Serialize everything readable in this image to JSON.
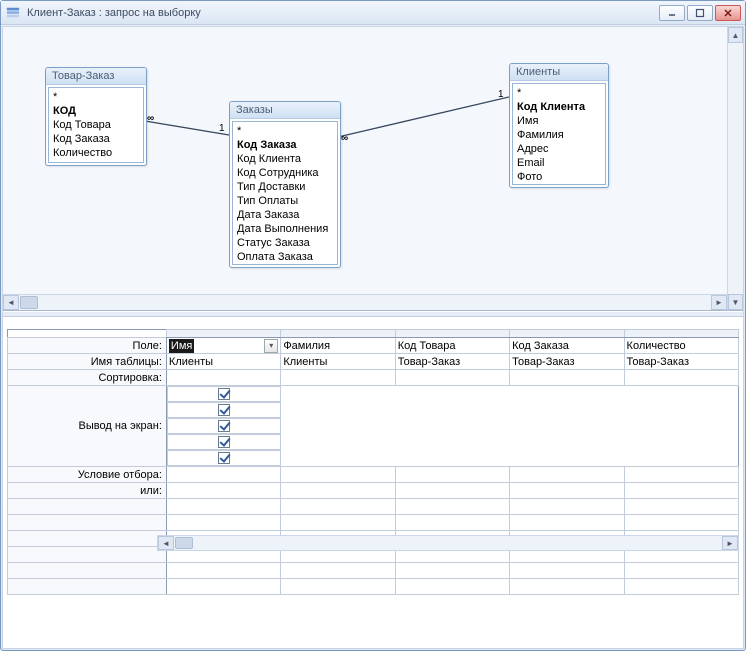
{
  "window": {
    "title": "Клиент-Заказ : запрос на выборку"
  },
  "tables": {
    "t1": {
      "title": "Товар-Заказ",
      "star": "*",
      "fields": [
        "КОД",
        "Код Товара",
        "Код Заказа",
        "Количество"
      ],
      "pk_index": 0
    },
    "t2": {
      "title": "Заказы",
      "star": "*",
      "fields": [
        "Код Заказа",
        "Код Клиента",
        "Код Сотрудника",
        "Тип Доставки",
        "Тип Оплаты",
        "Дата Заказа",
        "Дата Выполнения",
        "Статус Заказа",
        "Оплата Заказа"
      ],
      "pk_index": 0
    },
    "t3": {
      "title": "Клиенты",
      "star": "*",
      "fields": [
        "Код Клиента",
        "Имя",
        "Фамилия",
        "Адрес",
        "Email",
        "Фото"
      ],
      "pk_index": 0
    }
  },
  "relations": {
    "r12": {
      "left": "∞",
      "right": "1"
    },
    "r23": {
      "left": "∞",
      "right": "1"
    }
  },
  "grid": {
    "rows": {
      "field": "Поле:",
      "table": "Имя таблицы:",
      "sort": "Сортировка:",
      "show": "Вывод на экран:",
      "criteria": "Условие отбора:",
      "or": "или:"
    },
    "columns": [
      {
        "field": "Имя",
        "table": "Клиенты",
        "show": true,
        "active": true
      },
      {
        "field": "Фамилия",
        "table": "Клиенты",
        "show": true,
        "active": false
      },
      {
        "field": "Код Товара",
        "table": "Товар-Заказ",
        "show": true,
        "active": false
      },
      {
        "field": "Код Заказа",
        "table": "Товар-Заказ",
        "show": true,
        "active": false
      },
      {
        "field": "Количество",
        "table": "Товар-Заказ",
        "show": true,
        "active": false
      }
    ]
  }
}
